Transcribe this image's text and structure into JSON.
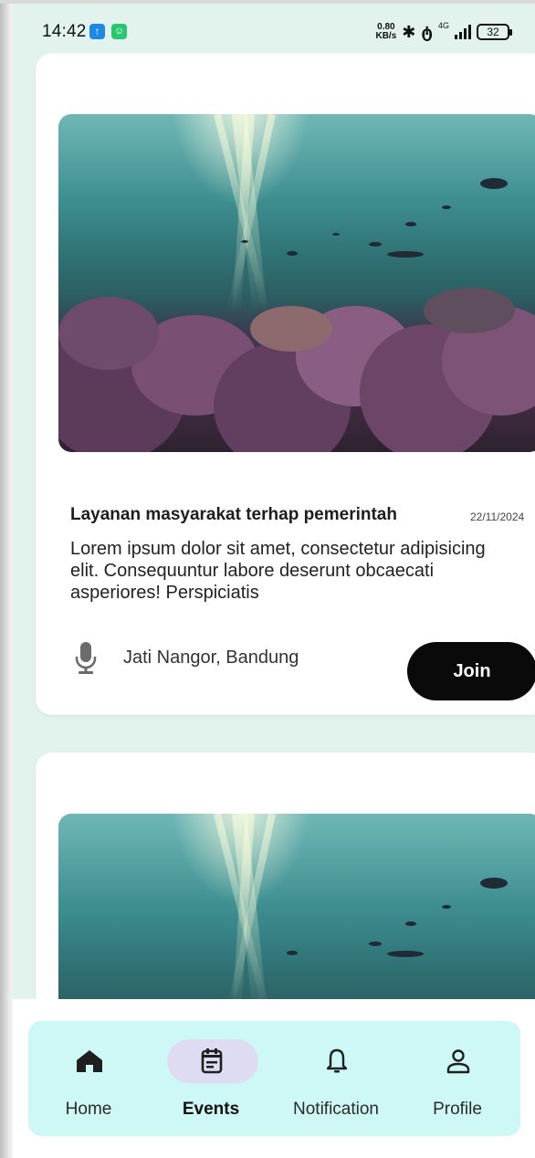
{
  "status_bar": {
    "time": "14:42",
    "net_speed_value": "0.80",
    "net_speed_unit": "KB/s",
    "network_type": "4G",
    "battery": "32"
  },
  "events": [
    {
      "title": "Layanan masyarakat terhap pemerintah",
      "date": "22/11/2024",
      "description": "Lorem ipsum dolor sit amet, consectetur adipisicing elit. Consequuntur labore deserunt obcaecati asperiores! Perspiciatis",
      "location": "Jati Nangor, Bandung",
      "join_label": "Join",
      "image_icon": "underwater-reef-image",
      "location_icon": "microphone-icon"
    },
    {
      "image_icon": "underwater-reef-image"
    }
  ],
  "bottom_nav": {
    "items": [
      {
        "label": "Home",
        "icon": "home-icon",
        "active": false
      },
      {
        "label": "Events",
        "icon": "calendar-icon",
        "active": true
      },
      {
        "label": "Notification",
        "icon": "bell-icon",
        "active": false
      },
      {
        "label": "Profile",
        "icon": "person-icon",
        "active": false
      }
    ]
  },
  "colors": {
    "background": "#e2f3ee",
    "nav_background": "#cdf8f6",
    "active_pill": "#dedcf2",
    "join_button": "#0a0a0a"
  }
}
